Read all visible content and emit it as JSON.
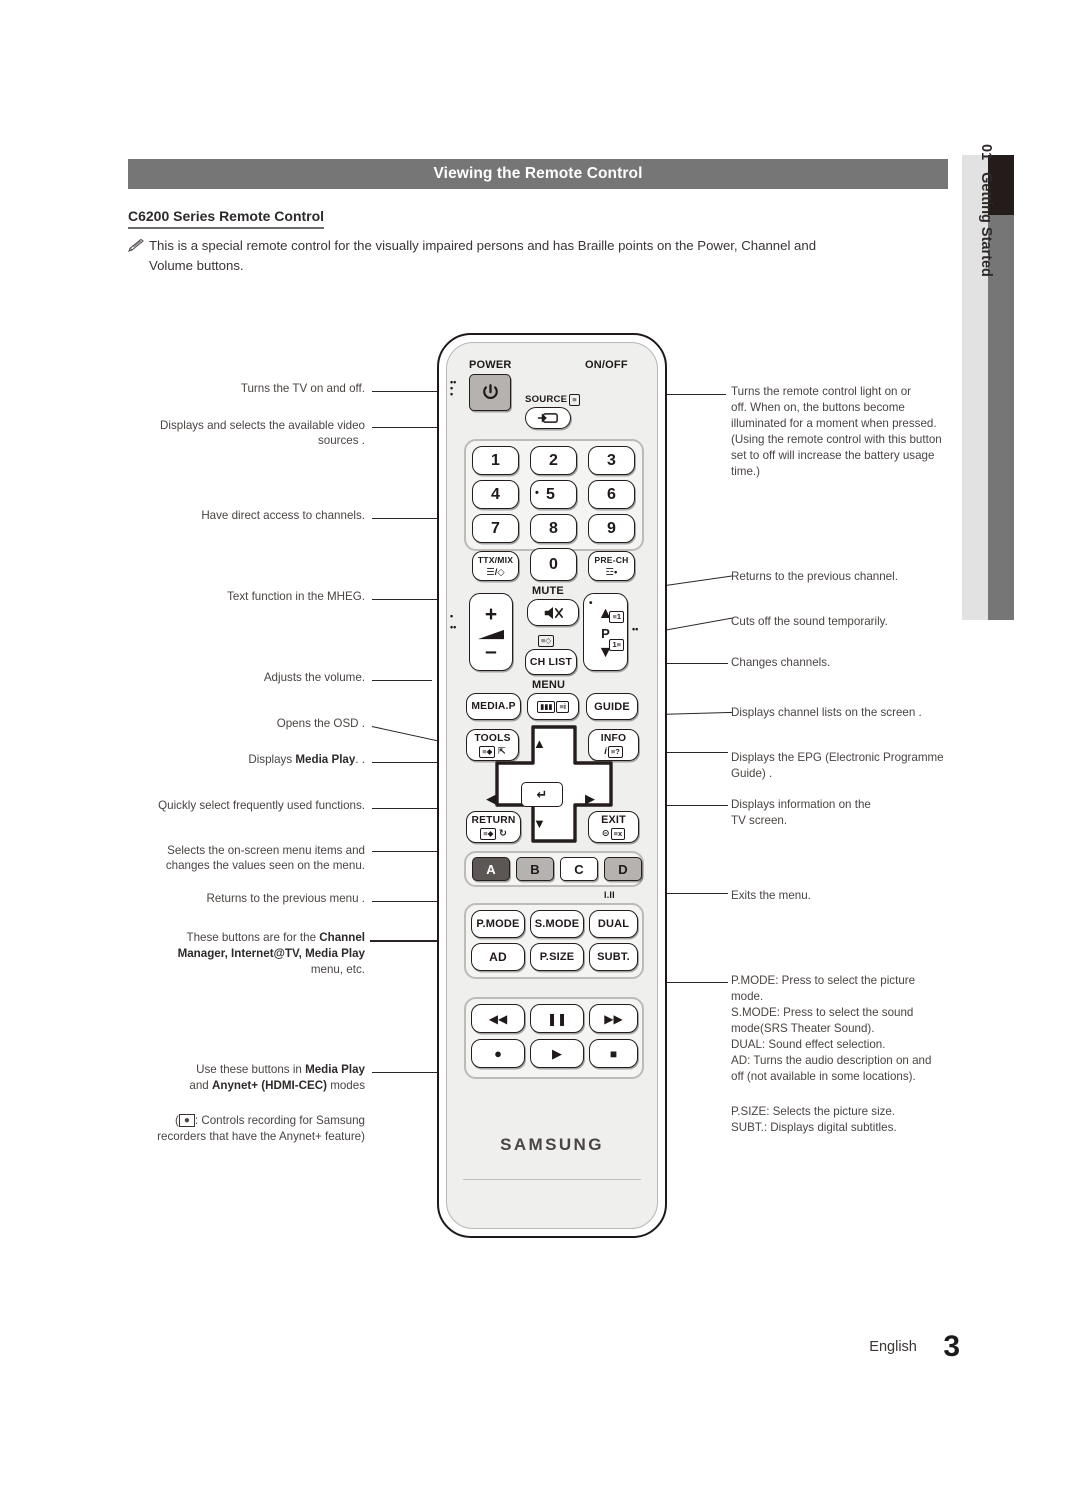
{
  "page": {
    "title": "Viewing the Remote Control",
    "section_heading": "C6200 Series Remote Control",
    "note_icon": "pencil-note-icon",
    "note_line1": "This is a special remote control for the visually impaired persons and has Braille points on the Power, Channel and",
    "note_line2": "Volume buttons.",
    "tab_number": "01",
    "tab_label": "Getting Started",
    "footer_language": "English",
    "footer_page": "3",
    "accent_grey": "#767676",
    "accent_dark": "#241c1b"
  },
  "callouts_left": [
    {
      "id": "power",
      "text": "Turns the TV on and off."
    },
    {
      "id": "source_l1",
      "text": "Displays and selects the available video"
    },
    {
      "id": "source_l2",
      "text": "sources ."
    },
    {
      "id": "numbers",
      "text": "Have direct access to channels."
    },
    {
      "id": "ttxmix",
      "text": "Text function in the MHEG."
    },
    {
      "id": "volume",
      "text": "Adjusts the volume."
    },
    {
      "id": "menu",
      "text": "Opens the OSD ."
    },
    {
      "id": "mediap_pre",
      "text": "Displays "
    },
    {
      "id": "mediap_b",
      "text": "Media Play"
    },
    {
      "id": "mediap_post",
      "text": ". ."
    },
    {
      "id": "tools",
      "text": "Quickly select frequently used functions."
    },
    {
      "id": "arrows_l1",
      "text": "Selects the on-screen menu items and"
    },
    {
      "id": "arrows_l2",
      "text": "changes the values seen on the menu."
    },
    {
      "id": "return",
      "text": "Returns to the previous menu ."
    },
    {
      "id": "abcd_l1a",
      "text": "These buttons are for the "
    },
    {
      "id": "abcd_l1b",
      "text": "Channel"
    },
    {
      "id": "abcd_l2",
      "text": "Manager, Internet@TV, Media Play"
    },
    {
      "id": "abcd_l3",
      "text": "menu, etc."
    },
    {
      "id": "media_l1a",
      "text": "Use these buttons in "
    },
    {
      "id": "media_l1b",
      "text": "Media Play"
    },
    {
      "id": "media_l2a",
      "text": "and "
    },
    {
      "id": "media_l2b",
      "text": "Anynet+ (HDMI-CEC)"
    },
    {
      "id": "media_l2c",
      "text": " modes"
    },
    {
      "id": "rec_l1a",
      "text": "("
    },
    {
      "id": "rec_l1b",
      "text": ": Controls recording for Samsung"
    },
    {
      "id": "rec_l2",
      "text": "recorders that have the Anynet+ feature)"
    }
  ],
  "callouts_right": [
    {
      "id": "onoff_l1",
      "text": "Turns the remote control light on or"
    },
    {
      "id": "onoff_l2",
      "text": "off. When on, the buttons become"
    },
    {
      "id": "onoff_l3",
      "text": "illuminated for a moment when pressed."
    },
    {
      "id": "onoff_l4",
      "text": "(Using the remote control with this button"
    },
    {
      "id": "onoff_l5",
      "text": "set to off will increase  the battery usage"
    },
    {
      "id": "onoff_l6",
      "text": "time.)"
    },
    {
      "id": "prech",
      "text": "Returns to the previous channel."
    },
    {
      "id": "mute",
      "text": "Cuts off the sound temporarily."
    },
    {
      "id": "chup",
      "text": "Changes channels."
    },
    {
      "id": "chlist",
      "text": "Displays channel lists on the screen ."
    },
    {
      "id": "guide_l1",
      "text": "Displays the EPG (Electronic Programme"
    },
    {
      "id": "guide_l2",
      "text": "Guide) ."
    },
    {
      "id": "info_l1",
      "text": "Displays information on the"
    },
    {
      "id": "info_l2",
      "text": "TV screen."
    },
    {
      "id": "exit",
      "text": "Exits the menu."
    },
    {
      "id": "pmode_l1",
      "text": "P.MODE: Press to select the picture"
    },
    {
      "id": "pmode_l2",
      "text": "mode."
    },
    {
      "id": "smode_l1",
      "text": "S.MODE: Press to select the sound"
    },
    {
      "id": "smode_l2",
      "text": "mode(SRS Theater Sound)."
    },
    {
      "id": "dual",
      "text": "DUAL: Sound effect selection."
    },
    {
      "id": "ad_l1",
      "text": "AD: Turns the audio description on and"
    },
    {
      "id": "ad_l2",
      "text": "off (not available in some locations)."
    },
    {
      "id": "psize",
      "text": "P.SIZE: Selects the picture size."
    },
    {
      "id": "subt",
      "text": "SUBT.: Displays digital subtitles."
    }
  ],
  "remote": {
    "brand": "SAMSUNG",
    "labels": {
      "power": "POWER",
      "onoff": "ON/OFF",
      "source": "SOURCE",
      "mute": "MUTE",
      "menu": "MENU",
      "p_channel": "P",
      "io": "I.II"
    },
    "numbers": [
      "1",
      "2",
      "3",
      "4",
      "5",
      "6",
      "7",
      "8",
      "9",
      "0"
    ],
    "keys": {
      "ttxmix": "TTX/MIX",
      "prech": "PRE-CH",
      "chlist": "CH LIST",
      "mediap": "MEDIA.P",
      "guide": "GUIDE",
      "tools": "TOOLS",
      "info": "INFO",
      "return": "RETURN",
      "exit": "EXIT"
    },
    "color_keys": [
      "A",
      "B",
      "C",
      "D"
    ],
    "function_keys": [
      "P.MODE",
      "S.MODE",
      "DUAL",
      "AD",
      "P.SIZE",
      "SUBT."
    ],
    "transport": [
      "rewind-icon",
      "pause-icon",
      "fast-forward-icon",
      "record-icon",
      "play-icon",
      "stop-icon"
    ]
  }
}
